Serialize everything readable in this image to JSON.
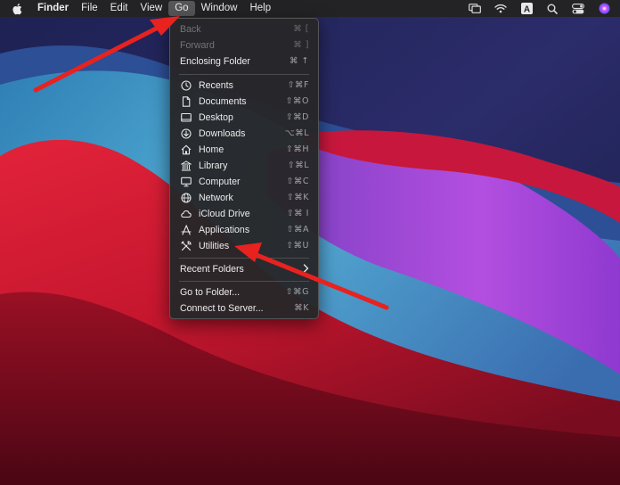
{
  "menubar": {
    "app_name": "Finder",
    "items": [
      "File",
      "Edit",
      "View",
      "Go",
      "Window",
      "Help"
    ],
    "active_item": "Go",
    "status_icons": [
      "screen-mirroring-icon",
      "wifi-icon",
      "input-source-icon",
      "search-icon",
      "control-center-icon",
      "siri-icon"
    ],
    "input_source_letter": "A"
  },
  "go_menu": {
    "top": [
      {
        "label": "Back",
        "shortcut": "⌘ [",
        "enabled": false
      },
      {
        "label": "Forward",
        "shortcut": "⌘ ]",
        "enabled": false
      },
      {
        "label": "Enclosing Folder",
        "shortcut": "⌘ ↑",
        "enabled": true
      }
    ],
    "places": [
      {
        "label": "Recents",
        "shortcut": "⇧⌘F",
        "icon": "clock-icon"
      },
      {
        "label": "Documents",
        "shortcut": "⇧⌘O",
        "icon": "document-icon"
      },
      {
        "label": "Desktop",
        "shortcut": "⇧⌘D",
        "icon": "desktop-icon"
      },
      {
        "label": "Downloads",
        "shortcut": "⌥⌘L",
        "icon": "download-icon"
      },
      {
        "label": "Home",
        "shortcut": "⇧⌘H",
        "icon": "house-icon"
      },
      {
        "label": "Library",
        "shortcut": "⇧⌘L",
        "icon": "library-icon"
      },
      {
        "label": "Computer",
        "shortcut": "⇧⌘C",
        "icon": "monitor-icon"
      },
      {
        "label": "Network",
        "shortcut": "⇧⌘K",
        "icon": "globe-icon"
      },
      {
        "label": "iCloud Drive",
        "shortcut": "⇧⌘ I",
        "icon": "cloud-icon"
      },
      {
        "label": "Applications",
        "shortcut": "⇧⌘A",
        "icon": "applications-icon"
      },
      {
        "label": "Utilities",
        "shortcut": "⇧⌘U",
        "icon": "utilities-icon"
      }
    ],
    "recent_folders": {
      "label": "Recent Folders",
      "submenu": true
    },
    "bottom": [
      {
        "label": "Go to Folder...",
        "shortcut": "⇧⌘G"
      },
      {
        "label": "Connect to Server...",
        "shortcut": "⌘K"
      }
    ]
  },
  "annotations": {
    "arrow_color": "#e8221f",
    "count": 2
  },
  "colors": {
    "menubar": "#232325",
    "menu_bg": "#272729",
    "text": "#ececec",
    "disabled": "#747476"
  }
}
